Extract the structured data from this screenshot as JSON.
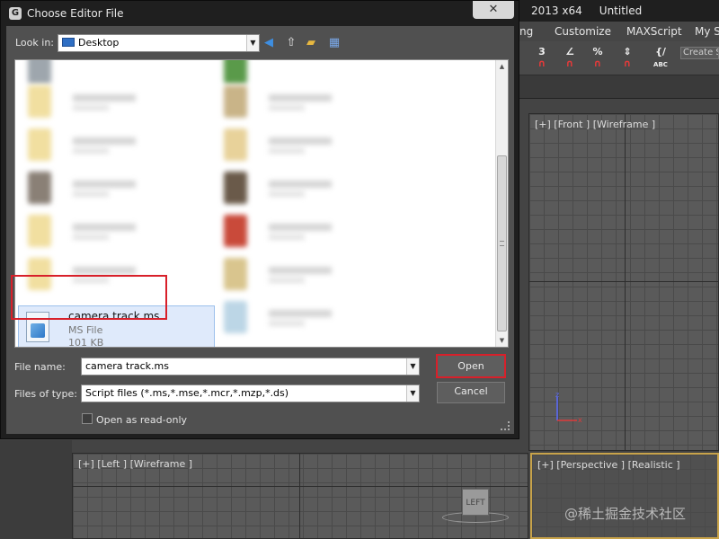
{
  "app": {
    "title": "2013 x64     Untitled",
    "menu": [
      "ng",
      "Customize",
      "MAXScript",
      "My S"
    ],
    "toolbar": {
      "snap_3": "3",
      "percent_snap": "%",
      "create_selection": "Create S"
    },
    "viewports": {
      "front": "[+] [Front ] [Wireframe ]",
      "left": "[+] [Left ] [Wireframe ]",
      "perspective": "[+] [Perspective ] [Realistic ]"
    },
    "axis": {
      "z": "z",
      "x": "x"
    },
    "viewcube_label": "LEFT"
  },
  "dialog": {
    "title": "Choose Editor File",
    "close_glyph": "✕",
    "look_in_label": "Look in:",
    "look_in_value": "Desktop",
    "selected_file": {
      "name": "camera track.ms",
      "type": "MS File",
      "size": "101 KB"
    },
    "file_name_label": "File name:",
    "file_name_value": "camera track.ms",
    "file_type_label": "Files of type:",
    "file_type_value": "Script files (*.ms,*.mse,*.mcr,*.mzp,*.ds)",
    "open_button": "Open",
    "cancel_button": "Cancel",
    "read_only_label": "Open as read-only"
  },
  "colors": {
    "highlight": "#d8202a",
    "dialog_bg": "#505050",
    "viewport_active": "#c8a34a"
  },
  "watermark": "@稀土掘金技术社区"
}
